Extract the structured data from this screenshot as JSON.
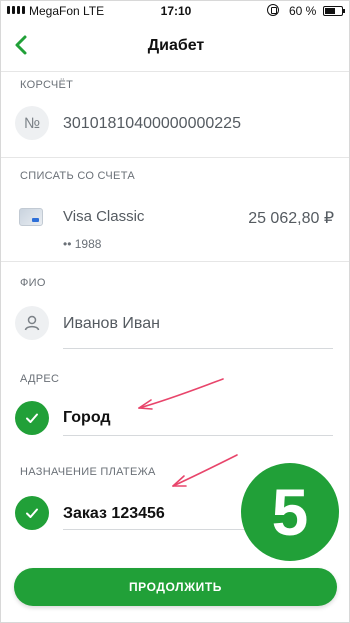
{
  "status_bar": {
    "carrier": "MegaFon",
    "network": "LTE",
    "time": "17:10",
    "battery": "60 %"
  },
  "nav": {
    "back_icon": "chevron-left-icon",
    "title": "Диабет"
  },
  "korr_account": {
    "label": "КОРСЧЁТ",
    "icon": "№",
    "value": "30101810400000000225"
  },
  "debit_account": {
    "label": "СПИСАТЬ СО СЧЕТА",
    "card_name": "Visa Classic",
    "balance": "25 062,80 ₽",
    "card_number": "•• 1988"
  },
  "fio": {
    "label": "ФИО",
    "value": "Иванов Иван"
  },
  "address": {
    "label": "АДРЕС",
    "value": "Город"
  },
  "purpose": {
    "label": "НАЗНАЧЕНИЕ ПЛАТЕЖА",
    "value": "Заказ 123456"
  },
  "step_badge": "5",
  "continue_button": "ПРОДОЛЖИТЬ",
  "colors": {
    "accent": "#21a038",
    "annotation": "#e8456b"
  }
}
